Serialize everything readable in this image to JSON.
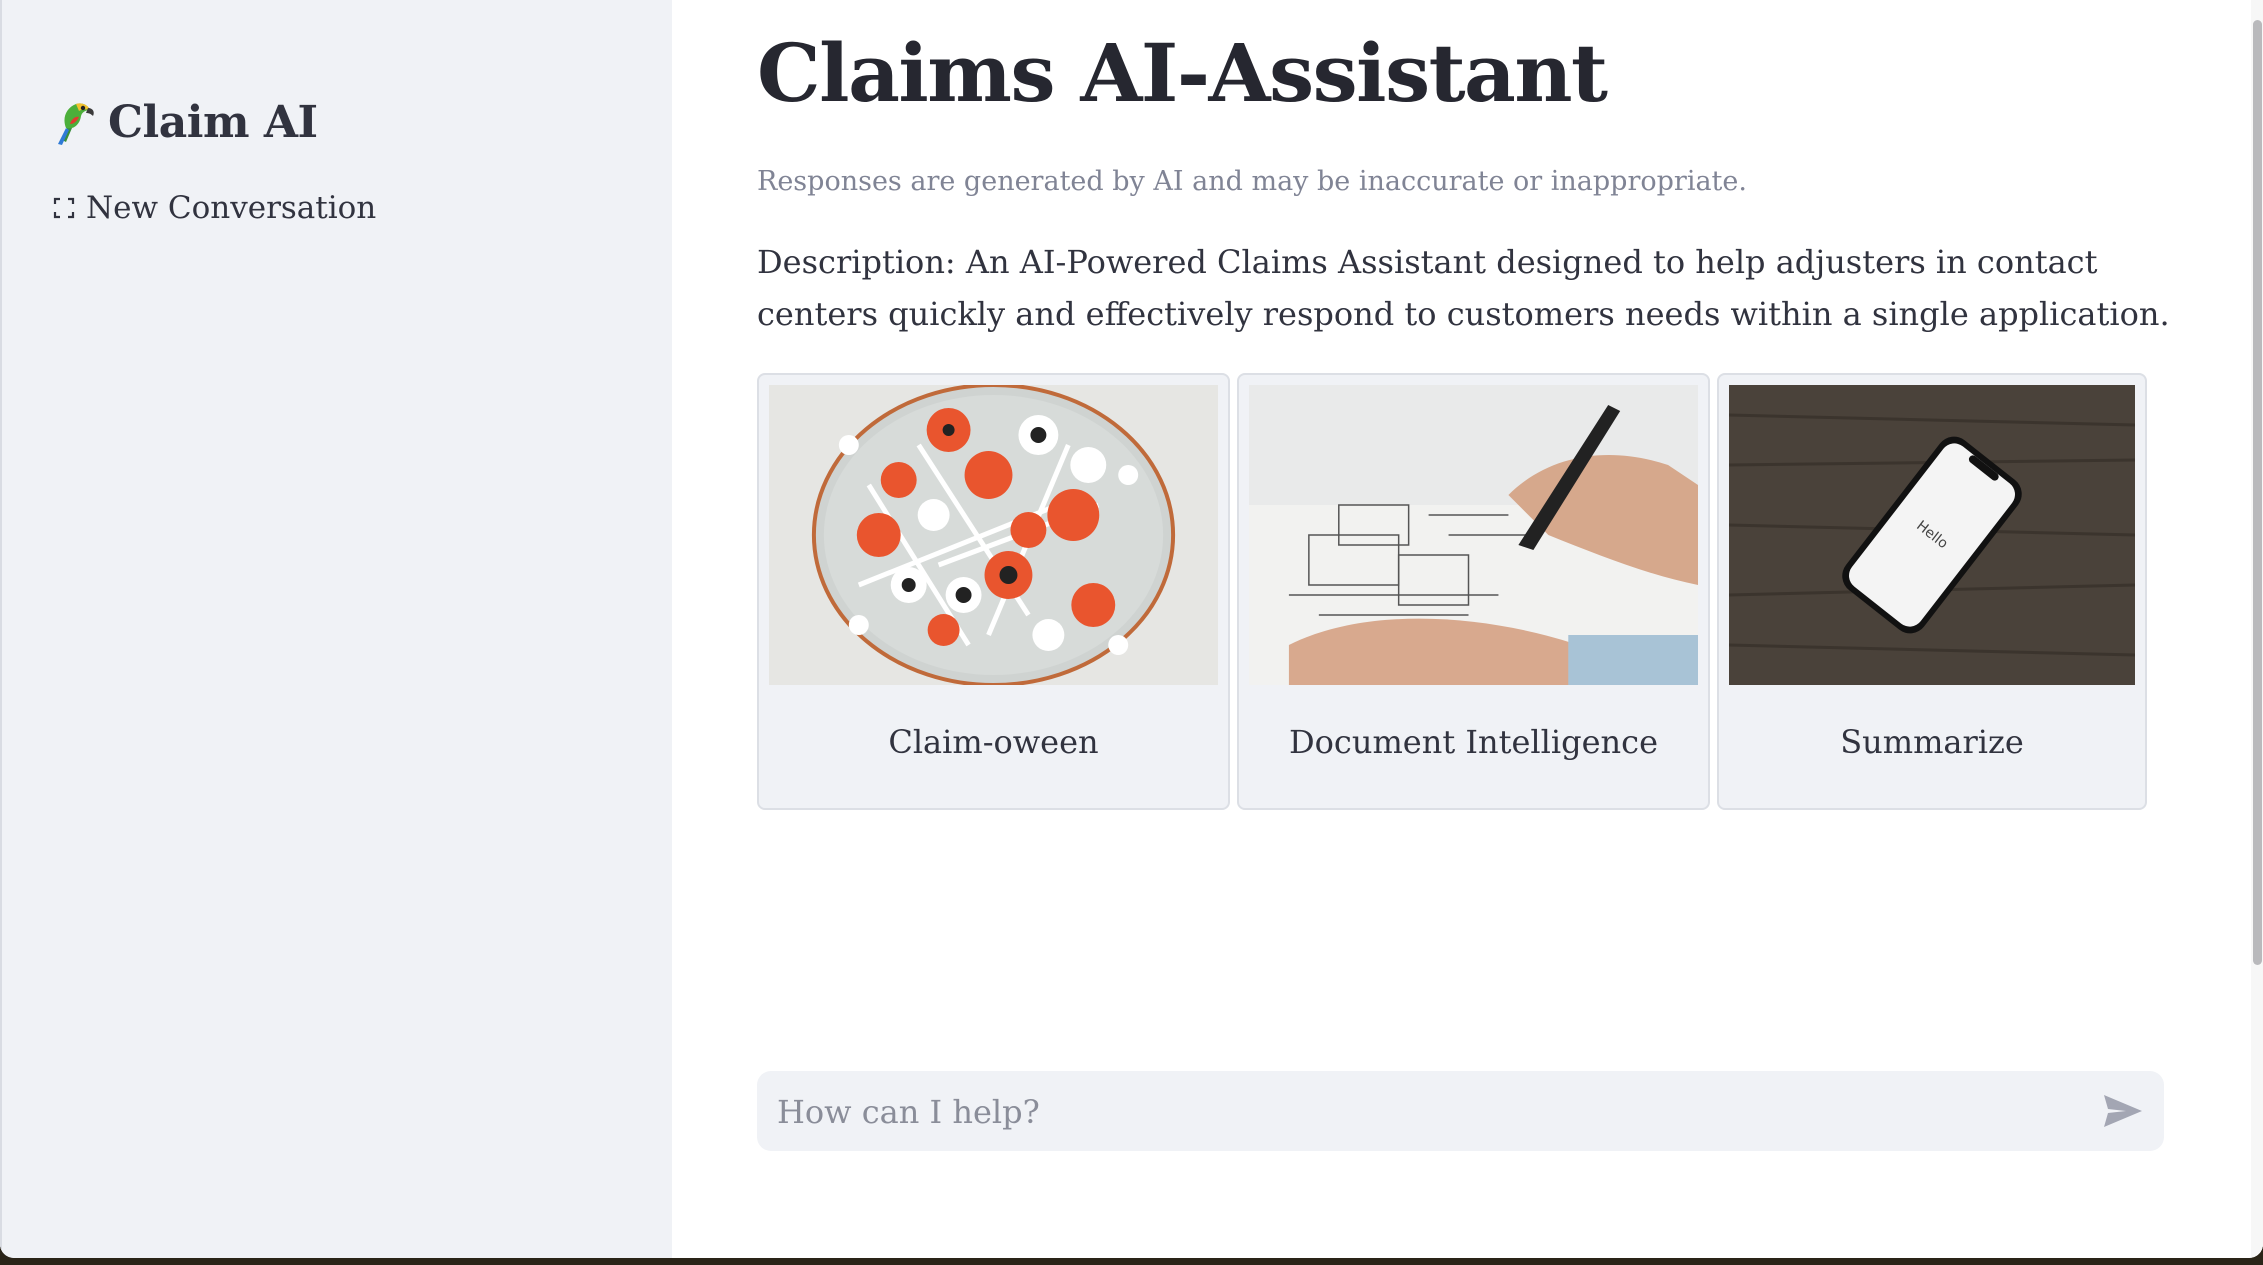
{
  "sidebar": {
    "brand_title": "Claim AI",
    "brand_icon": "parrot-icon",
    "new_conversation_label": "New Conversation",
    "new_conversation_icon": "expand-icon"
  },
  "main": {
    "title": "Claims AI-Assistant",
    "disclaimer": "Responses are generated by AI and may be inaccurate or inappropriate.",
    "description": "Description: An AI-Powered Claims Assistant designed to help adjusters in contact centers quickly and effectively respond to customers needs within a single application.",
    "cards": [
      {
        "label": "Claim-oween",
        "image": "halloween-lollipops-photo"
      },
      {
        "label": "Document Intelligence",
        "image": "hand-drawing-blueprint-photo"
      },
      {
        "label": "Summarize",
        "image": "smartphone-on-wood-photo",
        "phone_text": "Hello"
      }
    ],
    "chat_input": {
      "placeholder": "How can I help?",
      "value": "",
      "send_icon": "send-icon"
    }
  },
  "colors": {
    "sidebar_bg": "#f0f2f6",
    "text": "#31333f",
    "muted": "#808495",
    "card_bg": "#f0f2f6"
  }
}
